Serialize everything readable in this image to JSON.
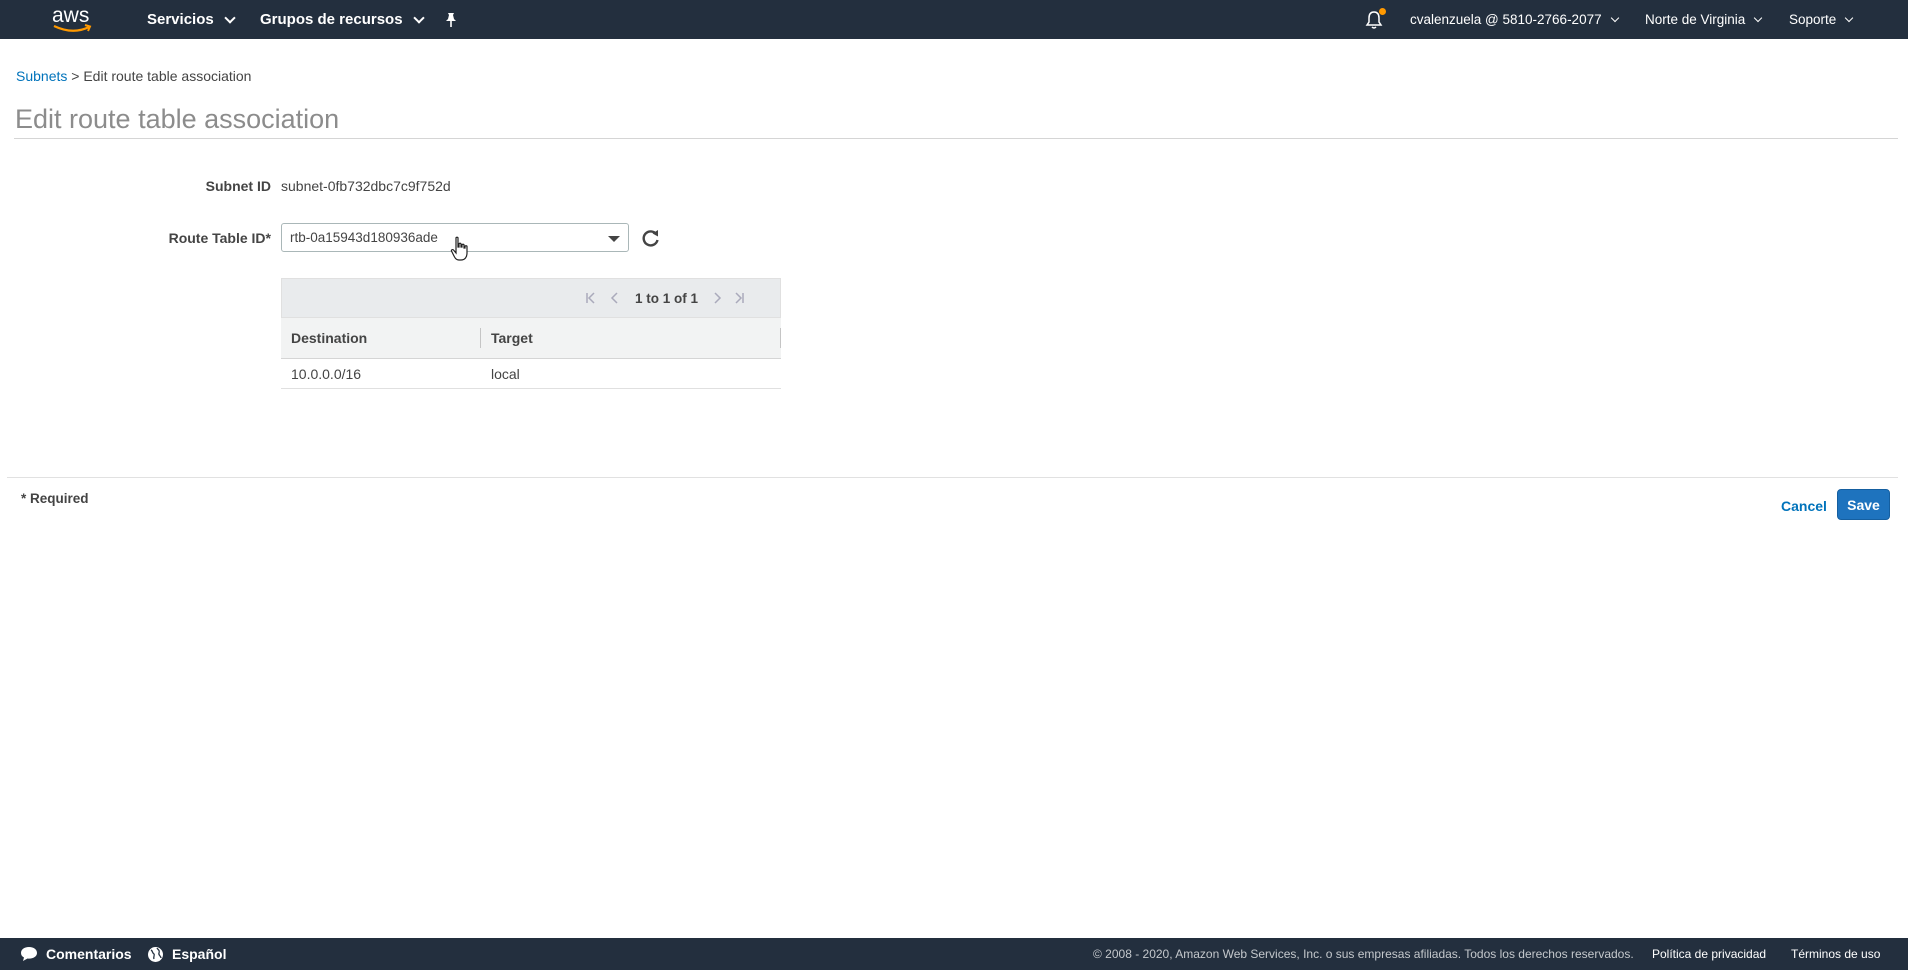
{
  "topnav": {
    "logo_text": "aws",
    "services_label": "Servicios",
    "resource_groups_label": "Grupos de recursos",
    "account_label": "cvalenzuela @ 5810-2766-2077",
    "region_label": "Norte de Virginia",
    "support_label": "Soporte",
    "icons": [
      "pin-icon",
      "bell-icon"
    ]
  },
  "breadcrumb": {
    "link": "Subnets",
    "separator": ">",
    "current": "Edit route table association"
  },
  "page_title": "Edit route table association",
  "form": {
    "subnet_id_label": "Subnet ID",
    "subnet_id_value": "subnet-0fb732dbc7c9f752d",
    "route_table_label": "Route Table ID*",
    "route_table_value": "rtb-0a15943d180936ade"
  },
  "route_table": {
    "pagination": "1 to 1 of 1",
    "columns": [
      "Destination",
      "Target"
    ],
    "rows": [
      [
        "10.0.0.0/16",
        "local"
      ]
    ]
  },
  "form_footer": {
    "required_note": "* Required",
    "cancel_label": "Cancel",
    "save_label": "Save"
  },
  "footer": {
    "feedback_label": "Comentarios",
    "language_label": "Español",
    "copyright": "© 2008 - 2020, Amazon Web Services, Inc. o sus empresas afiliadas. Todos los derechos reservados.",
    "privacy_label": "Política de privacidad",
    "terms_label": "Términos de uso"
  },
  "colors": {
    "nav_bg": "#232f3e",
    "link": "#0073bb",
    "primary_button": "#1e73be",
    "notification_dot": "#ff9900"
  }
}
